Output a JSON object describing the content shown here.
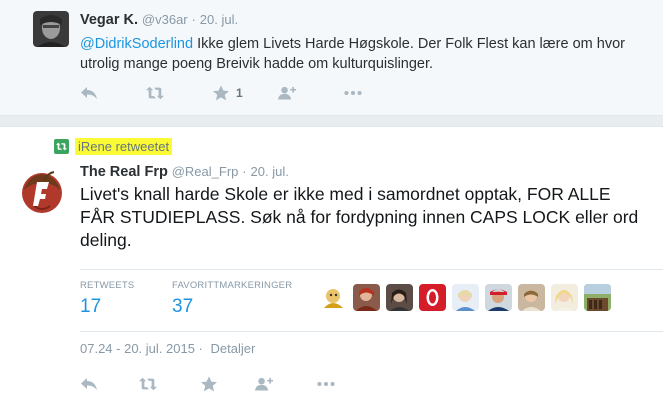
{
  "tweet1": {
    "name": "Vegar K.",
    "handle": "@v36ar",
    "separator": "·",
    "time": "20. jul.",
    "mention": "@DidrikSoderlind",
    "text": " Ikke glem Livets Harde Høgskole. Der Folk Flest kan lære om hvor utrolig mange poeng Breivik hadde om kulturquislinger.",
    "actions": {
      "favorite_count": "1"
    }
  },
  "retweet_context": {
    "text": "iRene retweetet"
  },
  "tweet2": {
    "name": "The Real Frp",
    "handle": "@Real_Frp",
    "separator": "·",
    "time": "20. jul.",
    "text": "Livet's knall harde Skole er ikke med i samordnet opptak, FOR ALLE FÅR STUDIEPLASS. Søk nå for fordypning innen CAPS LOCK eller ord deling.",
    "stats": {
      "retweets_label": "RETWEETS",
      "retweets_value": "17",
      "favorites_label": "FAVORITTMARKERINGER",
      "favorites_value": "37"
    },
    "timestamp": "07.24 - 20. jul. 2015",
    "meta_sep": "·",
    "details_link": "Detaljer"
  },
  "colors": {
    "link": "#1b95e0",
    "retweet_green": "#3ba45f",
    "highlight": "#fbfb35",
    "muted": "#8899a6",
    "icon": "#aab8c2"
  },
  "icons": [
    "reply-icon",
    "retweet-icon",
    "favorite-star-icon",
    "follow-add-user-icon",
    "more-dots-icon"
  ]
}
